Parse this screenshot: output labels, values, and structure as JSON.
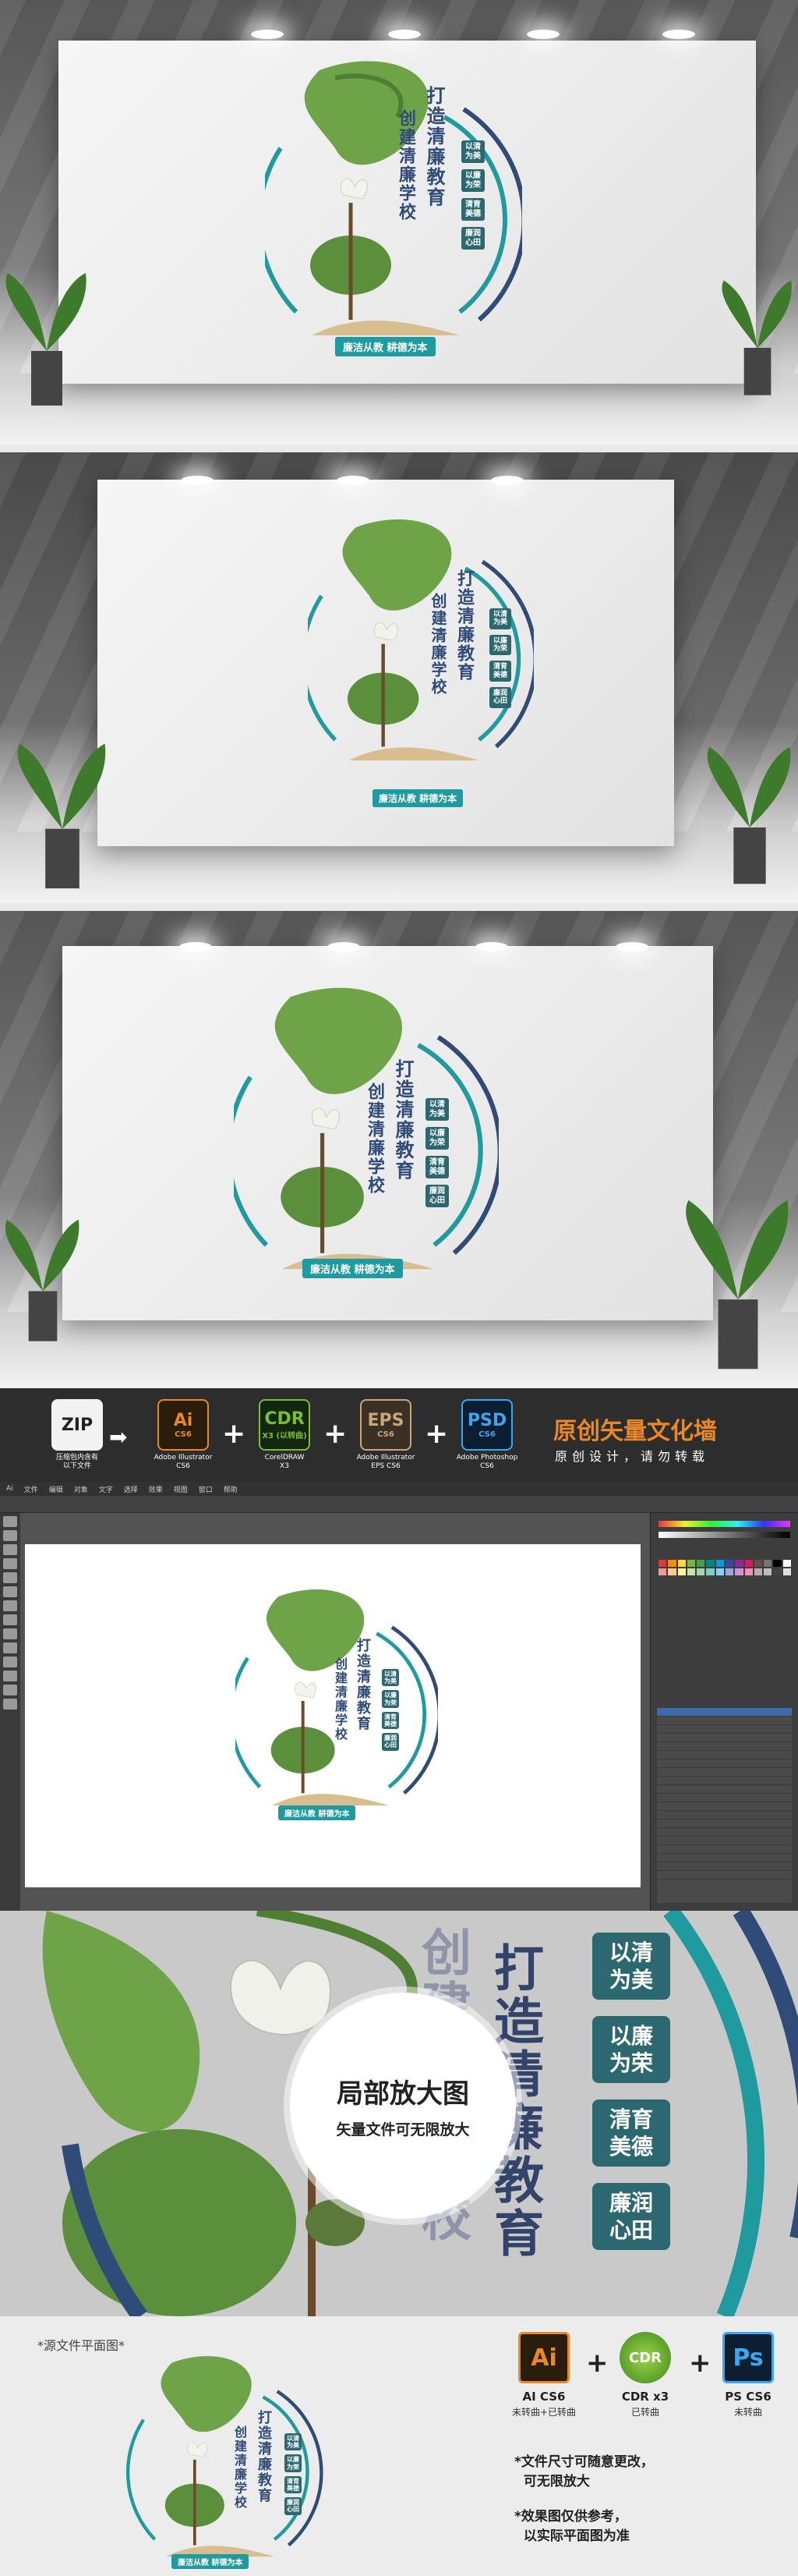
{
  "sign": {
    "title": "打造清廉教育",
    "subtitle": "创建清廉学校",
    "badges": [
      "以清为美",
      "以廉为荣",
      "清育美德",
      "廉润心田"
    ],
    "slogan": "廉洁从教    耕德为本"
  },
  "formats": {
    "zip": {
      "big": "ZIP",
      "label": "压缩包内含有\n以下文件"
    },
    "items": [
      {
        "big": "Ai",
        "small": "CS6",
        "label": "Adobe Illustrator\nCS6"
      },
      {
        "big": "CDR",
        "small": "X3 (以转曲)",
        "label": "CorelDRAW\nX3"
      },
      {
        "big": "EPS",
        "small": "CS6",
        "label": "Adobe Illustrator\nEPS CS6"
      },
      {
        "big": "PSD",
        "small": "CS6",
        "label": "Adobe Photoshop\nCS6"
      }
    ],
    "title": "原创矢量文化墙",
    "subtitle": "原创设计，请勿转载"
  },
  "editor": {
    "menu": [
      "Ai",
      "文件",
      "编辑",
      "对象",
      "文字",
      "选择",
      "效果",
      "视图",
      "窗口",
      "帮助"
    ]
  },
  "zoom": {
    "title": "局部放大图",
    "subtitle": "矢量文件可无限放大",
    "left_text": "创建清廉学校",
    "right_text": "打造清廉教育",
    "badges": [
      "以清\n为美",
      "以廉\n为荣",
      "清育\n美德",
      "廉润\n心田"
    ]
  },
  "bottom": {
    "label": "*源文件平面图*",
    "apps": [
      {
        "icon": "Ai",
        "name": "AI CS6",
        "sub": "未转曲+已转曲"
      },
      {
        "icon": "CDR",
        "name": "CDR x3",
        "sub": "已转曲"
      },
      {
        "icon": "Ps",
        "name": "PS CS6",
        "sub": "未转曲"
      }
    ],
    "notes": [
      "*文件尺寸可随意更改，\n  可无限放大",
      "*效果图仅供参考，\n  以实际平面图为准"
    ]
  },
  "colors": {
    "leaf": "#6ea348",
    "teal": "#1f9a9e",
    "navy": "#2f4b78",
    "badge": "#2b6870",
    "ai_orange": "#e98826"
  }
}
